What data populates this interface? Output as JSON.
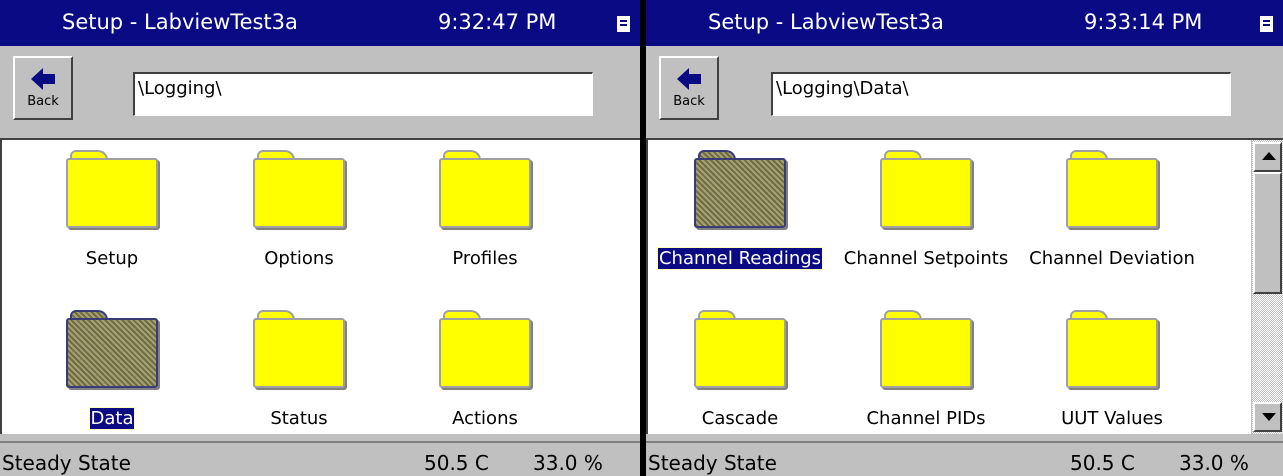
{
  "left": {
    "title": "Setup - LabviewTest3a",
    "time": "9:32:47 PM",
    "back_label": "Back",
    "path": "\\Logging\\",
    "items": [
      {
        "label": "Setup",
        "selected": false
      },
      {
        "label": "Options",
        "selected": false
      },
      {
        "label": "Profiles",
        "selected": false
      },
      {
        "label": "Data",
        "selected": true
      },
      {
        "label": "Status",
        "selected": false
      },
      {
        "label": "Actions",
        "selected": false
      }
    ],
    "status": {
      "state": "Steady State",
      "temp": "50.5 C",
      "percent": "33.0 %"
    }
  },
  "right": {
    "title": "Setup - LabviewTest3a",
    "time": "9:33:14 PM",
    "back_label": "Back",
    "path": "\\Logging\\Data\\",
    "items": [
      {
        "label": "Channel Readings",
        "selected": true
      },
      {
        "label": "Channel Setpoints",
        "selected": false
      },
      {
        "label": "Channel Deviation",
        "selected": false
      },
      {
        "label": "Cascade",
        "selected": false
      },
      {
        "label": "Channel PIDs",
        "selected": false
      },
      {
        "label": "UUT Values",
        "selected": false
      }
    ],
    "status": {
      "state": "Steady State",
      "temp": "50.5 C",
      "percent": "33.0 %"
    }
  },
  "colors": {
    "titlebar": "#0a0a84",
    "folder": "#ffff00",
    "window_bg": "#c0c0c0",
    "selection": "#0a0a84"
  },
  "icons": [
    "back-arrow-icon",
    "folder-icon",
    "window-menu-icon",
    "scroll-up-icon",
    "scroll-down-icon"
  ]
}
